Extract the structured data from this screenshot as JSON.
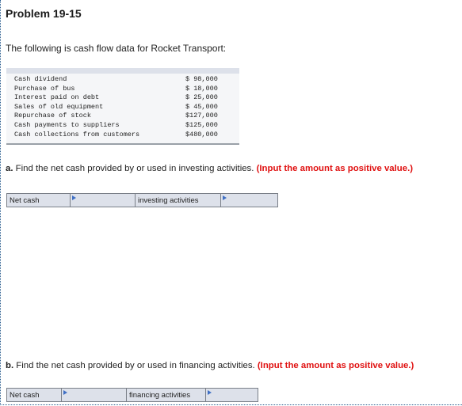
{
  "header": {
    "title": "Problem 19-15"
  },
  "intro": "The following is cash flow data for Rocket Transport:",
  "cash_flow_data": [
    {
      "label": "Cash dividend",
      "value": "$ 98,000"
    },
    {
      "label": "Purchase of bus",
      "value": "$ 18,000"
    },
    {
      "label": "Interest paid on debt",
      "value": "$ 25,000"
    },
    {
      "label": "Sales of old equipment",
      "value": "$ 45,000"
    },
    {
      "label": "Repurchase of stock",
      "value": "$127,000"
    },
    {
      "label": "Cash payments to suppliers",
      "value": "$125,000"
    },
    {
      "label": "Cash collections from customers",
      "value": "$480,000"
    }
  ],
  "questions": [
    {
      "letter": "a.",
      "text": " Find the net cash provided by or used in investing activities. ",
      "note": "(Input the amount as positive value.)",
      "answer_row": {
        "label": "Net cash",
        "dropdown_value": "",
        "activity_label": "investing activities",
        "amount_value": ""
      }
    },
    {
      "letter": "b.",
      "text": " Find the net cash provided by or used in financing activities. ",
      "note": "(Input the amount as positive value.)",
      "answer_row": {
        "label": "Net cash",
        "dropdown_value": "",
        "activity_label": "financing activities",
        "amount_value": ""
      }
    }
  ],
  "colors": {
    "accent_red": "#e01010",
    "dropdown_marker": "#3f6fc4",
    "cell_bg": "#dde1ea"
  }
}
